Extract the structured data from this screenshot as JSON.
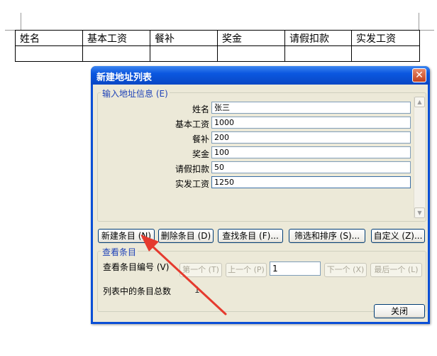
{
  "doc": {
    "table_headers": [
      "姓名",
      "基本工资",
      "餐补",
      "奖金",
      "请假扣款",
      "实发工资"
    ]
  },
  "dialog": {
    "title": "新建地址列表",
    "close_glyph": "✕",
    "input_group_label": "输入地址信息 (E)",
    "fields": [
      {
        "label": "姓名",
        "value": "张三"
      },
      {
        "label": "基本工资",
        "value": "1000"
      },
      {
        "label": "餐补",
        "value": "200"
      },
      {
        "label": "奖金",
        "value": "100"
      },
      {
        "label": "请假扣款",
        "value": "50"
      },
      {
        "label": "实发工资",
        "value": "1250"
      }
    ],
    "buttons": {
      "new_entry": "新建条目 (N)",
      "delete_entry": "删除条目 (D)",
      "find_entry": "查找条目 (F)...",
      "filter_sort": "筛选和排序 (S)...",
      "customize": "自定义 (Z)..."
    },
    "view_group_label": "查看条目",
    "view_entry_number_label": "查看条目编号 (V)",
    "nav": {
      "first": "第一个 (T)",
      "prev": "上一个 (P)",
      "current": "1",
      "next": "下一个 (X)",
      "last": "最后一个 (L)"
    },
    "total_label": "列表中的条目总数",
    "total_value": "1",
    "close_label": "关闭"
  },
  "colors": {
    "annotation_arrow": "#e53a2e",
    "title_bar": "#0b57e0",
    "dialog_face": "#ece9d8"
  }
}
